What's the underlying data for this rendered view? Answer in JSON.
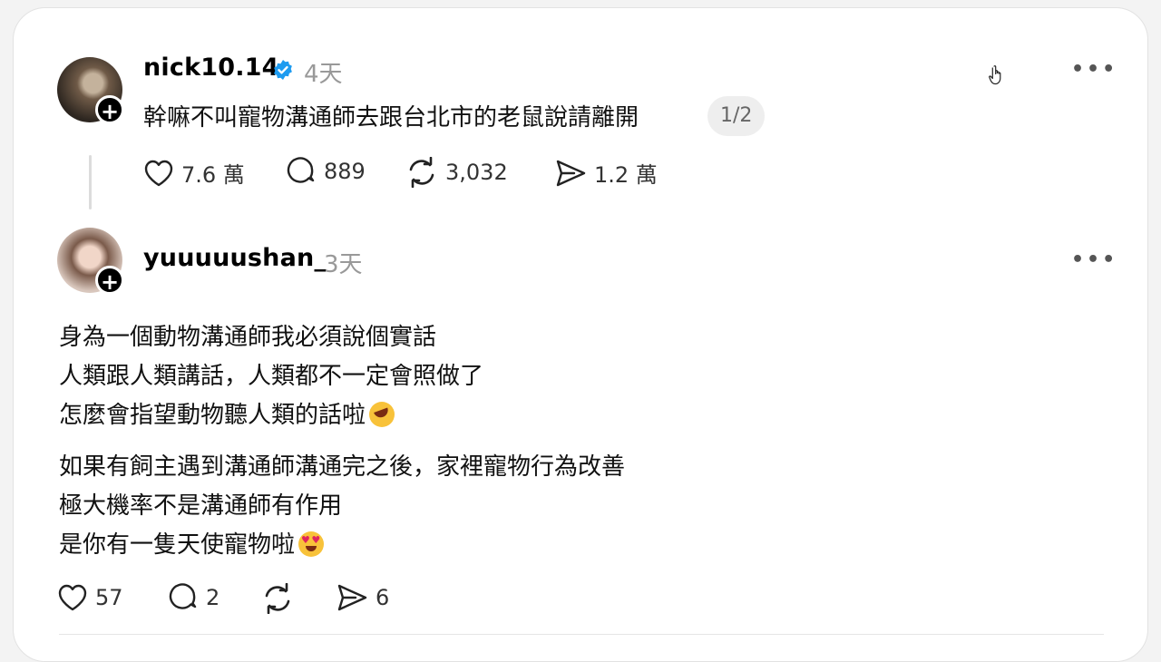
{
  "post1": {
    "username": "nick10.14",
    "time": "4天",
    "text": "幹嘛不叫寵物溝通師去跟台北市的老鼠說請離開",
    "page_indicator": "1/2",
    "likes": "7.6 萬",
    "replies": "889",
    "reposts": "3,032",
    "shares": "1.2 萬",
    "more_icon": "more-horizontal-icon",
    "verified_icon": "verified-badge-icon"
  },
  "post2": {
    "username": "yuuuuushan_",
    "time": "3天",
    "lines": [
      "身為一個動物溝通師我必須說個實話",
      "人類跟人類講話，人類都不一定會照做了",
      "怎麼會指望動物聽人類的話啦",
      "如果有飼主遇到溝通師溝通完之後，家裡寵物行為改善",
      "極大機率不是溝通師有作用",
      "是你有一隻天使寵物啦"
    ],
    "likes": "57",
    "replies": "2",
    "shares": "6"
  },
  "follow_symbol": "+",
  "more_symbol": "•••",
  "colors": {
    "verified": "#1d9bf0",
    "muted": "#999999",
    "text": "#111111"
  }
}
